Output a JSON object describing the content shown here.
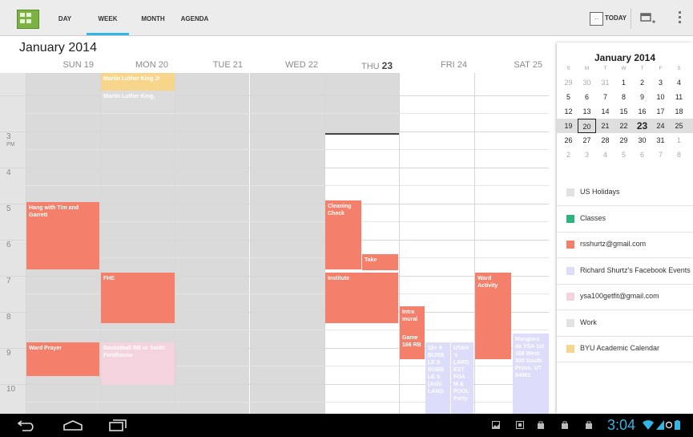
{
  "toolbar": {
    "tabs": [
      "DAY",
      "WEEK",
      "MONTH",
      "AGENDA"
    ],
    "active_tab": "WEEK",
    "today_label": "TODAY",
    "today_icon_text": "··"
  },
  "month_title": "January 2014",
  "day_headers": [
    {
      "dow": "SUN",
      "num": "19"
    },
    {
      "dow": "MON",
      "num": "20"
    },
    {
      "dow": "TUE",
      "num": "21"
    },
    {
      "dow": "WED",
      "num": "22"
    },
    {
      "dow": "THU",
      "num": "23"
    },
    {
      "dow": "FRI",
      "num": "24"
    },
    {
      "dow": "SAT",
      "num": "25"
    }
  ],
  "hour_labels": [
    {
      "hour": "3",
      "ampm": "PM"
    },
    {
      "hour": "4",
      "ampm": ""
    },
    {
      "hour": "5",
      "ampm": ""
    },
    {
      "hour": "6",
      "ampm": ""
    },
    {
      "hour": "7",
      "ampm": ""
    },
    {
      "hour": "8",
      "ampm": ""
    },
    {
      "hour": "9",
      "ampm": ""
    },
    {
      "hour": "10",
      "ampm": ""
    }
  ],
  "events": [
    {
      "title": "Martin Luther King Jr",
      "color": "#f7d58a"
    },
    {
      "title": "Martin Luther King,",
      "color": "#dcdcdc"
    },
    {
      "title": "Hang with Tim and Garrett",
      "color": "#f4806c"
    },
    {
      "title": "FHE",
      "color": "#f4806c"
    },
    {
      "title": "Ward Prayer",
      "color": "#f4806c"
    },
    {
      "title": "Basketball RB or Smith Fieldhouse",
      "color": "#f4d3de"
    },
    {
      "title": "Cleaning Check",
      "color": "#f4806c"
    },
    {
      "title": "Take",
      "color": "#f4806c"
    },
    {
      "title": "Institute",
      "color": "#f4806c"
    },
    {
      "title": "Intra mural",
      "color": "#f4806c"
    },
    {
      "title": "Game 166 RB",
      "color": "#f4806c"
    },
    {
      "title": "18+ 9 BURB LE S BUBB LE S (Ashl LANG",
      "color": "#dcdcfb"
    },
    {
      "title": "UTAH 's LARG EST FOA M & POOL Party",
      "color": "#dcdcfb"
    },
    {
      "title": "Ward Activity",
      "color": "#f4806c"
    },
    {
      "title": "Mangoes de YSA 1st 168 West 300 South Provo, UT 84061",
      "color": "#dcdcfb"
    }
  ],
  "mini_calendar": {
    "title": "January 2014",
    "dow": [
      "S",
      "M",
      "T",
      "W",
      "T",
      "F",
      "S"
    ],
    "weeks": [
      [
        "29",
        "30",
        "31",
        "1",
        "2",
        "3",
        "4"
      ],
      [
        "5",
        "6",
        "7",
        "8",
        "9",
        "10",
        "11"
      ],
      [
        "12",
        "13",
        "14",
        "15",
        "16",
        "17",
        "18"
      ],
      [
        "19",
        "20",
        "21",
        "22",
        "23",
        "24",
        "25"
      ],
      [
        "26",
        "27",
        "28",
        "29",
        "30",
        "31",
        "1"
      ],
      [
        "2",
        "3",
        "4",
        "5",
        "6",
        "7",
        "8"
      ]
    ],
    "selected": "20",
    "today": "23"
  },
  "calendars": [
    {
      "name": "US Holidays",
      "color": "#e2e2e2"
    },
    {
      "name": "Classes",
      "color": "#2db37d"
    },
    {
      "name": "rsshurtz@gmail.com",
      "color": "#f4806c"
    },
    {
      "name": "Richard Shurtz's Facebook Events",
      "color": "#dcdcfb"
    },
    {
      "name": "ysa100getfit@gmail.com",
      "color": "#f4d3de"
    },
    {
      "name": "Work",
      "color": "#e2e2e2"
    },
    {
      "name": "BYU Academic Calendar",
      "color": "#f7d58a"
    }
  ],
  "status_bar": {
    "time": "3:04"
  },
  "colors": {
    "accent": "#33b5e5",
    "event_red": "#f4806c",
    "past_gray": "#dadada"
  }
}
